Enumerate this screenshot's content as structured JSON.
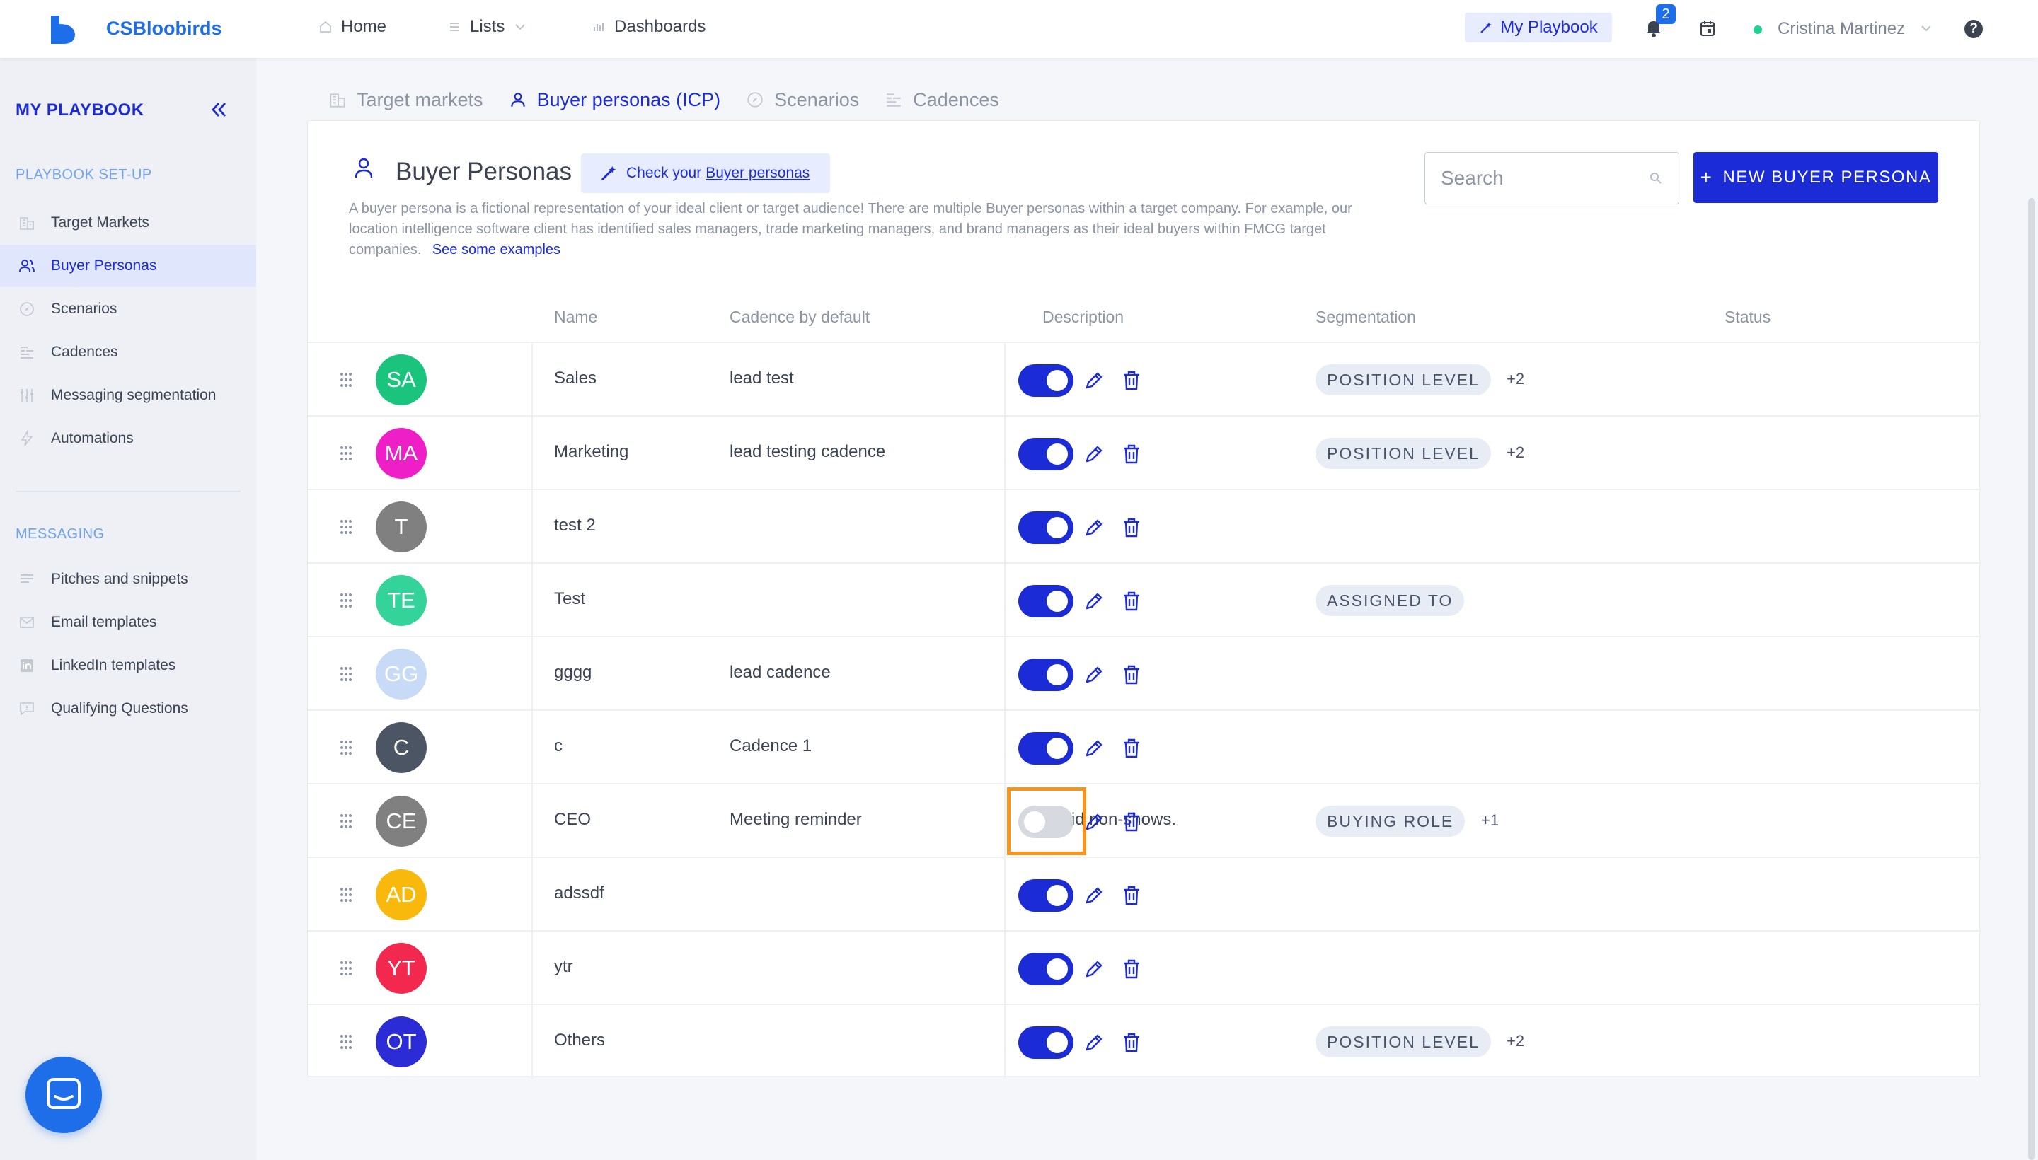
{
  "topbar": {
    "brand": "CSBloobirds",
    "nav": [
      {
        "label": "Home",
        "icon": "home-icon"
      },
      {
        "label": "Lists",
        "icon": "list-icon"
      },
      {
        "label": "Dashboards",
        "icon": "dashboard-icon"
      }
    ],
    "playbook_label": "My Playbook",
    "notifications_count": "2",
    "user_name": "Cristina Martinez",
    "help_label": "?"
  },
  "sidebar": {
    "title": "MY PLAYBOOK",
    "setup_section": "PLAYBOOK SET-UP",
    "setup_items": [
      {
        "label": "Target Markets",
        "icon": "building-icon"
      },
      {
        "label": "Buyer Personas",
        "icon": "people-icon"
      },
      {
        "label": "Scenarios",
        "icon": "compass-icon"
      },
      {
        "label": "Cadences",
        "icon": "cadence-icon"
      },
      {
        "label": "Messaging segmentation",
        "icon": "sliders-icon"
      },
      {
        "label": "Automations",
        "icon": "lightning-icon"
      }
    ],
    "messaging_section": "MESSAGING",
    "messaging_items": [
      {
        "label": "Pitches and snippets",
        "icon": "snippet-icon"
      },
      {
        "label": "Email templates",
        "icon": "mail-icon"
      },
      {
        "label": "LinkedIn templates",
        "icon": "linkedin-icon"
      },
      {
        "label": "Qualifying Questions",
        "icon": "question-bubble-icon"
      }
    ],
    "active_item": "Buyer Personas"
  },
  "tabs": [
    {
      "label": "Target markets",
      "icon": "building-icon"
    },
    {
      "label": "Buyer personas (ICP)",
      "icon": "person-icon"
    },
    {
      "label": "Scenarios",
      "icon": "compass-icon"
    },
    {
      "label": "Cadences",
      "icon": "cadence-icon"
    }
  ],
  "active_tab": "Buyer personas (ICP)",
  "main": {
    "title": "Buyer Personas",
    "check_prefix": "Check your",
    "check_link": "Buyer personas",
    "description": "A buyer persona is a fictional representation of your ideal client or target audience! There are multiple Buyer personas within a target company. For example, our location intelligence software client has identified sales managers, trade marketing managers, and brand managers as their ideal buyers within FMCG target companies.",
    "examples_link": "See some examples",
    "search_placeholder": "Search",
    "new_button": "NEW BUYER PERSONA",
    "columns": {
      "name": "Name",
      "cadence": "Cadence by default",
      "description": "Description",
      "segmentation": "Segmentation",
      "status": "Status"
    }
  },
  "colors": {
    "primary": "#1b2bd6",
    "accent": "#1d6ee8",
    "highlight": "#f7941d"
  },
  "rows": [
    {
      "initials": "SA",
      "color": "#1bc47d",
      "name": "Sales",
      "cadence": "lead test",
      "description": "",
      "tag": "POSITION LEVEL",
      "more": "+2",
      "enabled": true
    },
    {
      "initials": "MA",
      "color": "#ee1fc7",
      "name": "Marketing",
      "cadence": "lead testing cadence",
      "description": "",
      "tag": "POSITION LEVEL",
      "more": "+2",
      "enabled": true
    },
    {
      "initials": "T",
      "color": "#808080",
      "name": "test 2",
      "cadence": "",
      "description": "",
      "tag": "",
      "more": "",
      "enabled": true
    },
    {
      "initials": "TE",
      "color": "#33d39a",
      "name": "Test",
      "cadence": "",
      "description": "",
      "tag": "ASSIGNED TO",
      "more": "",
      "enabled": true
    },
    {
      "initials": "GG",
      "color": "#c7dbf7",
      "name": "gggg",
      "cadence": "lead cadence",
      "description": "",
      "tag": "",
      "more": "",
      "enabled": true
    },
    {
      "initials": "C",
      "color": "#4b5563",
      "name": "c",
      "cadence": "Cadence 1",
      "description": "",
      "tag": "",
      "more": "",
      "enabled": true
    },
    {
      "initials": "CE",
      "color": "#808080",
      "name": "CEO",
      "cadence": "Meeting reminder",
      "description": "Avoid non-shows.",
      "tag": "BUYING ROLE",
      "more": "+1",
      "enabled": false
    },
    {
      "initials": "AD",
      "color": "#f9b80c",
      "name": "adssdf",
      "cadence": "",
      "description": "",
      "tag": "",
      "more": "",
      "enabled": true
    },
    {
      "initials": "YT",
      "color": "#f2284f",
      "name": "ytr",
      "cadence": "",
      "description": "",
      "tag": "",
      "more": "",
      "enabled": true
    },
    {
      "initials": "OT",
      "color": "#2c2cd6",
      "name": "Others",
      "cadence": "",
      "description": "",
      "tag": "POSITION LEVEL",
      "more": "+2",
      "enabled": true
    }
  ]
}
